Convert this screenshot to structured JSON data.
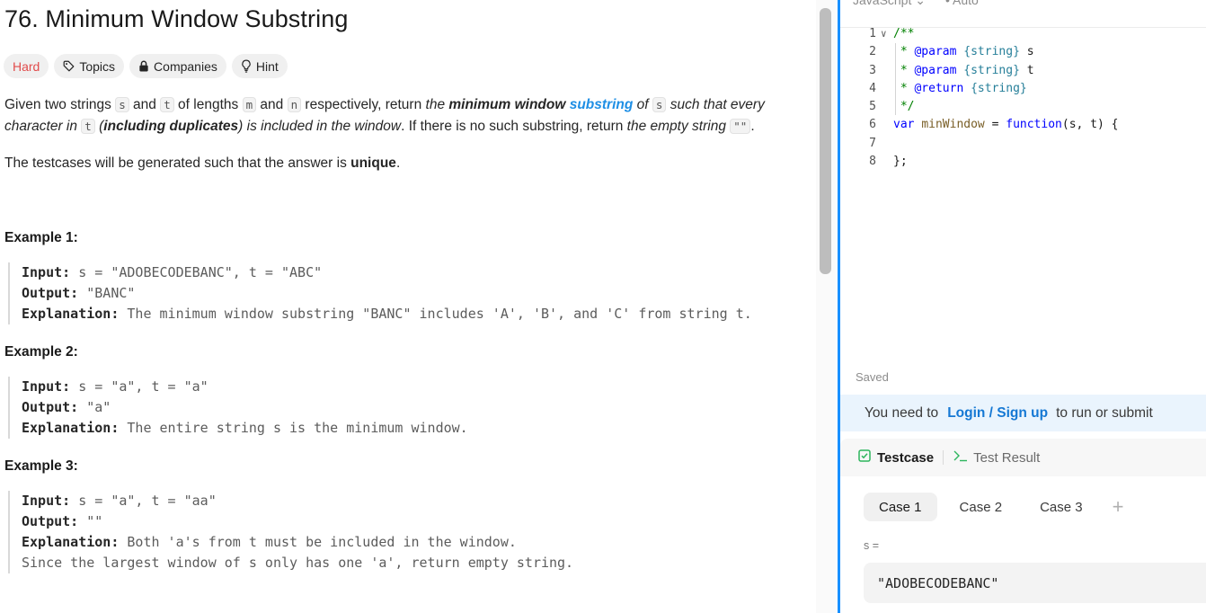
{
  "problem": {
    "title": "76. Minimum Window Substring",
    "tags": {
      "difficulty": "Hard",
      "topics": "Topics",
      "companies": "Companies",
      "hint": "Hint"
    },
    "description": {
      "p1_given": "Given two strings ",
      "s": "s",
      "and": " and ",
      "t": "t",
      "of_lengths": " of lengths ",
      "m": "m",
      "and2": " and ",
      "n": "n",
      "respectively": " respectively, return ",
      "the": "the ",
      "min_window": "minimum window",
      "space": " ",
      "substring": "substring",
      "of": " of ",
      "s2": "s",
      "such_that": " such that every character in ",
      "t2": "t",
      "including_open": " (",
      "including": "including duplicates",
      "is_included": ") is included in the window",
      "no_such": ". If there is no such substring, return ",
      "empty_string": "the empty string",
      "empty_code": "\"\"",
      "period": ".",
      "p2_pre": "The testcases will be generated such that the answer is ",
      "unique": "unique",
      "p2_post": "."
    },
    "examples": [
      {
        "title": "Example 1:",
        "input_label": "Input:",
        "input": " s = \"ADOBECODEBANC\", t = \"ABC\"",
        "output_label": "Output:",
        "output": " \"BANC\"",
        "explanation_label": "Explanation:",
        "explanation": " The minimum window substring \"BANC\" includes 'A', 'B', and 'C' from string t.",
        "extra": ""
      },
      {
        "title": "Example 2:",
        "input_label": "Input:",
        "input": " s = \"a\", t = \"a\"",
        "output_label": "Output:",
        "output": " \"a\"",
        "explanation_label": "Explanation:",
        "explanation": " The entire string s is the minimum window.",
        "extra": ""
      },
      {
        "title": "Example 3:",
        "input_label": "Input:",
        "input": " s = \"a\", t = \"aa\"",
        "output_label": "Output:",
        "output": " \"\"",
        "explanation_label": "Explanation:",
        "explanation": " Both 'a's from t must be included in the window.",
        "extra": "Since the largest window of s only has one 'a', return empty string."
      }
    ]
  },
  "editor": {
    "language": "JavaScript",
    "mode": "Auto",
    "lines": [
      {
        "n": "1",
        "parts": [
          [
            "c-com",
            "/**"
          ]
        ],
        "fold": true
      },
      {
        "n": "2",
        "parts": [
          [
            "c-com",
            " * "
          ],
          [
            "c-tag",
            "@param"
          ],
          [
            "c-com",
            " "
          ],
          [
            "c-type",
            "{string}"
          ],
          [
            "c-txt",
            " s"
          ]
        ],
        "fold": false
      },
      {
        "n": "3",
        "parts": [
          [
            "c-com",
            " * "
          ],
          [
            "c-tag",
            "@param"
          ],
          [
            "c-com",
            " "
          ],
          [
            "c-type",
            "{string}"
          ],
          [
            "c-txt",
            " t"
          ]
        ],
        "fold": false
      },
      {
        "n": "4",
        "parts": [
          [
            "c-com",
            " * "
          ],
          [
            "c-tag",
            "@return"
          ],
          [
            "c-com",
            " "
          ],
          [
            "c-type",
            "{string}"
          ]
        ],
        "fold": false
      },
      {
        "n": "5",
        "parts": [
          [
            "c-com",
            " */"
          ]
        ],
        "fold": false
      },
      {
        "n": "6",
        "parts": [
          [
            "c-kw",
            "var"
          ],
          [
            "c-txt",
            " "
          ],
          [
            "c-fn",
            "minWindow"
          ],
          [
            "c-txt",
            " = "
          ],
          [
            "c-kw",
            "function"
          ],
          [
            "c-txt",
            "(s, t) {"
          ]
        ],
        "fold": false
      },
      {
        "n": "7",
        "parts": [
          [
            "c-txt",
            ""
          ]
        ],
        "fold": false
      },
      {
        "n": "8",
        "parts": [
          [
            "c-txt",
            "};"
          ]
        ],
        "fold": false
      }
    ],
    "status": "Saved"
  },
  "login_prompt": {
    "prefix": "You need to",
    "link": "Login / Sign up",
    "suffix": "to run or submit"
  },
  "test_panel": {
    "tab_testcase": "Testcase",
    "tab_result": "Test Result",
    "cases": [
      "Case 1",
      "Case 2",
      "Case 3"
    ],
    "add_case_icon": "plus-icon",
    "var_label": "s =",
    "var_value": "\"ADOBECODEBANC\""
  },
  "colors": {
    "accent": "#1f8fe5",
    "hard": "#e14b4b",
    "divider": "#1890ff",
    "link": "#1578d4",
    "check": "#2db55d"
  }
}
